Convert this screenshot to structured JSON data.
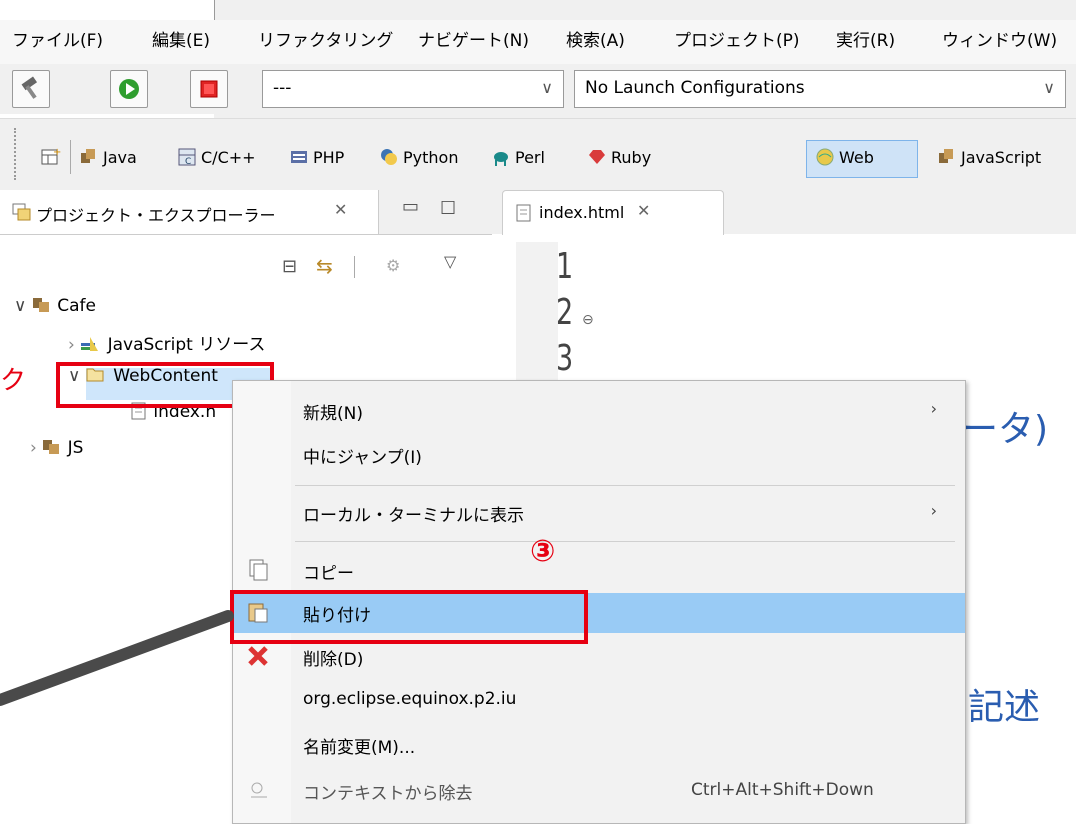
{
  "menu": {
    "items": [
      "ファイル(F)",
      "編集(E)",
      "リファクタリング",
      "ナビゲート(N)",
      "検索(A)",
      "プロジェクト(P)",
      "実行(R)",
      "ウィンドウ(W)"
    ]
  },
  "toolbar": {
    "config_combo": "---",
    "launch_combo": "No Launch Configurations"
  },
  "perspectives": {
    "items": [
      "Java",
      "C/C++",
      "PHP",
      "Python",
      "Perl",
      "Ruby",
      "Web",
      "JavaScript"
    ],
    "active": "Web"
  },
  "explorer": {
    "tab_title": "プロジェクト・エクスプローラー",
    "tree": {
      "cafe": "Cafe",
      "js_resources": "JavaScript リソース",
      "webcontent": "WebContent",
      "index_file": "index.h",
      "js": "JS"
    }
  },
  "editor": {
    "tab_title": "index.html",
    "line_numbers": [
      "1",
      "2",
      "3"
    ],
    "overflow_text_1": "ータ)",
    "overflow_text_2": "記述"
  },
  "context_menu": {
    "new": "新規(N)",
    "jump": "中にジャンプ(I)",
    "local_terminal": "ローカル・ターミナルに表示",
    "copy": "コピー",
    "paste": "貼り付け",
    "delete": "削除(D)",
    "p2iu": "org.eclipse.equinox.p2.iu",
    "rename": "名前変更(M)...",
    "remove_context": "コンテキストから除去",
    "remove_context_shortcut": "Ctrl+Alt+Shift+Down"
  },
  "annotations": {
    "step_marker": "③",
    "left_edge_text": "ク"
  },
  "colors": {
    "highlight": "#99cbf5",
    "annotation_red": "#e60012",
    "editor_text_blue": "#2a5db0"
  }
}
